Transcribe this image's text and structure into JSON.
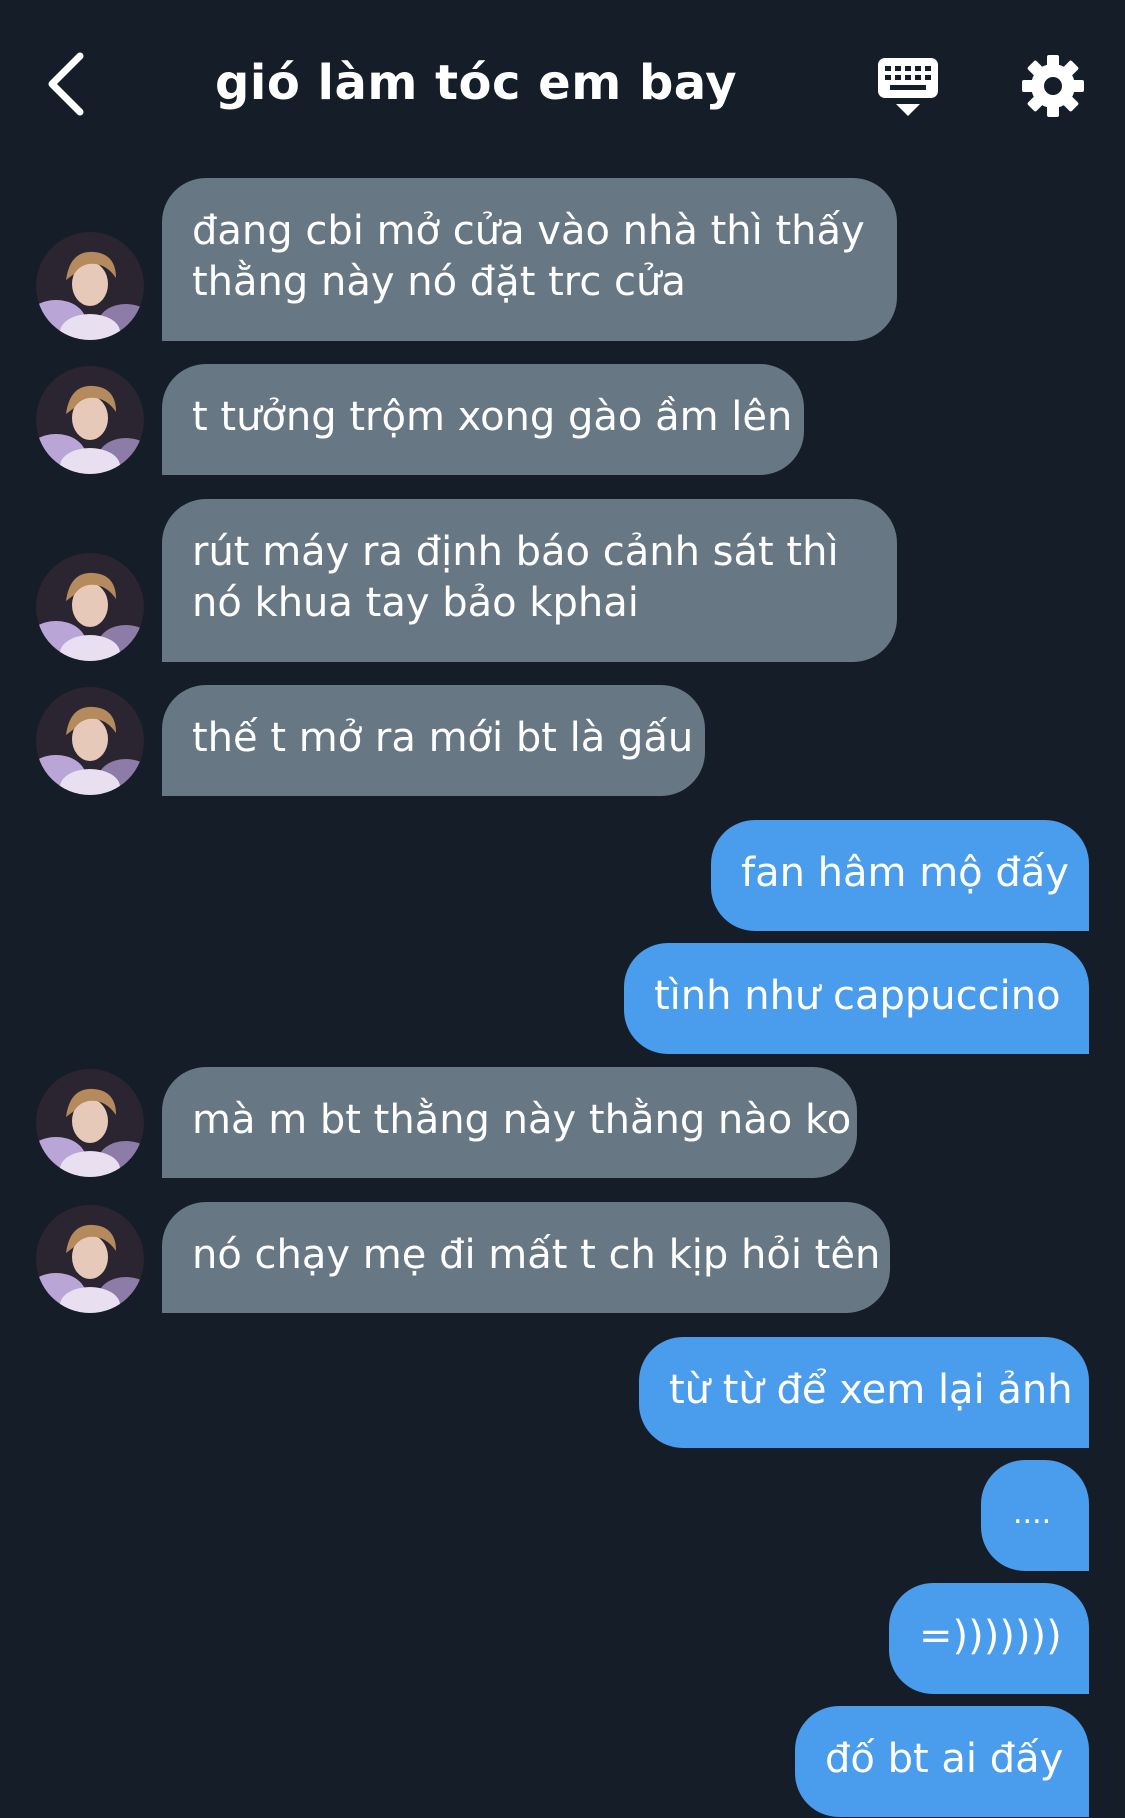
{
  "header": {
    "title": "gió làm tóc em bay",
    "back_icon": "chevron-left-icon",
    "keyboard_icon": "keyboard-icon",
    "settings_icon": "gear-icon"
  },
  "colors": {
    "background": "#151d28",
    "incoming_bubble": "#687784",
    "outgoing_bubble": "#4a9cec",
    "text": "#ffffff"
  },
  "messages": [
    {
      "side": "in",
      "line1": "đang cbi mở cửa vào nhà thì thấy",
      "line2": "thằng này nó đặt trc cửa"
    },
    {
      "side": "in",
      "line1": "t tưởng trộm xong gào ầm lên"
    },
    {
      "side": "in",
      "line1": "rút máy ra định báo cảnh sát thì",
      "line2": "nó khua tay bảo kphai"
    },
    {
      "side": "in",
      "line1": "thế t mở ra mới bt là gấu"
    },
    {
      "side": "out",
      "line1": "fan hâm mộ đấy"
    },
    {
      "side": "out",
      "line1": "tình như cappuccino"
    },
    {
      "side": "in",
      "line1": "mà m bt thằng này thằng nào ko"
    },
    {
      "side": "in",
      "line1": "nó chạy mẹ đi mất t ch kịp hỏi tên"
    },
    {
      "side": "out",
      "line1": "từ từ để xem lại ảnh"
    },
    {
      "side": "out",
      "line1": "...."
    },
    {
      "side": "out",
      "line1": "=)))))))"
    },
    {
      "side": "out",
      "line1": "đố bt ai đấy"
    }
  ]
}
